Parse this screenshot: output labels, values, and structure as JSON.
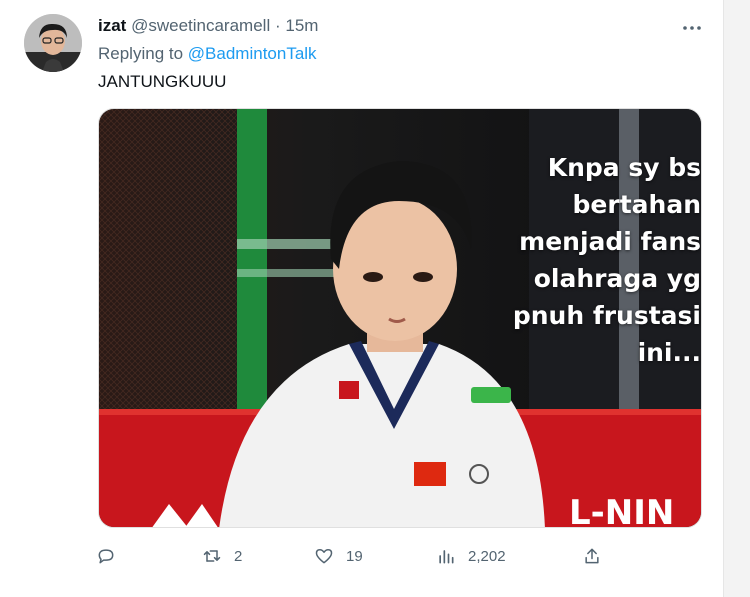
{
  "tweet": {
    "display_name": "izat",
    "handle": "@sweetincaramell",
    "separator": "·",
    "time": "15m",
    "replying_prefix": "Replying to",
    "replying_handle": "@BadmintonTalk",
    "text": "JANTUNGKUUU"
  },
  "media": {
    "caption": "Knpa sy bs\nbertahan\nmenjadi fans\nolahraga yg\npnuh frustasi\nini..."
  },
  "actions": {
    "reply_count": "",
    "retweet_count": "2",
    "like_count": "19",
    "view_count": "2,202"
  },
  "icons": {
    "more": "more-dots-icon",
    "reply": "reply-icon",
    "retweet": "retweet-icon",
    "like": "heart-icon",
    "views": "views-chart-icon",
    "share": "share-icon"
  },
  "colors": {
    "link": "#1d9bf0",
    "secondary_text": "#536471",
    "primary_text": "#0f1419"
  }
}
